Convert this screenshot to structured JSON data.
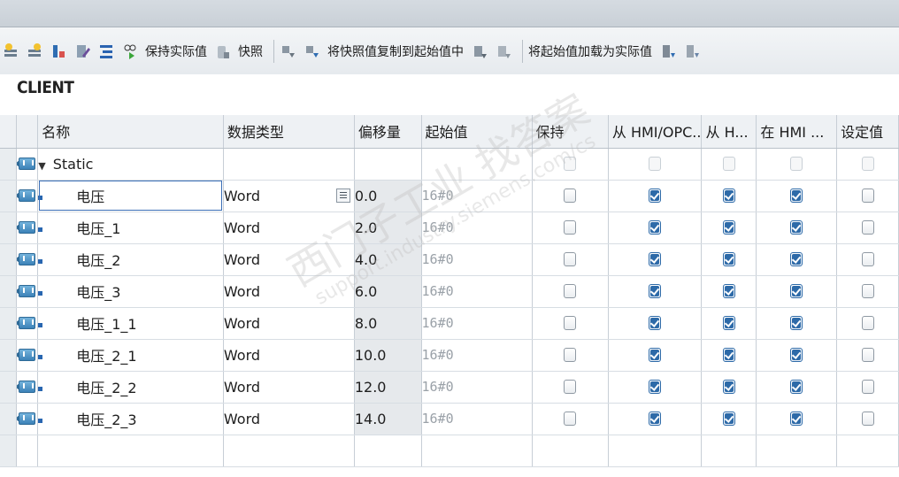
{
  "toolbar": {
    "keep_actual": "保持实际值",
    "snapshot": "快照",
    "copy_snapshot_to_start": "将快照值复制到起始值中",
    "load_start_as_actual": "将起始值加载为实际值"
  },
  "block_name": "CLIENT",
  "columns": {
    "name": "名称",
    "datatype": "数据类型",
    "offset": "偏移量",
    "start_value": "起始值",
    "retain": "保持",
    "from_hmi_opc": "从 HMI/OPC..",
    "from_h": "从 H...",
    "in_hmi": "在 HMI ...",
    "setpoint": "设定值"
  },
  "section": {
    "name": "Static"
  },
  "rows": [
    {
      "name": "电压",
      "datatype": "Word",
      "offset": "0.0",
      "start": "16#0"
    },
    {
      "name": "电压_1",
      "datatype": "Word",
      "offset": "2.0",
      "start": "16#0"
    },
    {
      "name": "电压_2",
      "datatype": "Word",
      "offset": "4.0",
      "start": "16#0"
    },
    {
      "name": "电压_3",
      "datatype": "Word",
      "offset": "6.0",
      "start": "16#0"
    },
    {
      "name": "电压_1_1",
      "datatype": "Word",
      "offset": "8.0",
      "start": "16#0"
    },
    {
      "name": "电压_2_1",
      "datatype": "Word",
      "offset": "10.0",
      "start": "16#0"
    },
    {
      "name": "电压_2_2",
      "datatype": "Word",
      "offset": "12.0",
      "start": "16#0"
    },
    {
      "name": "电压_2_3",
      "datatype": "Word",
      "offset": "14.0",
      "start": "16#0"
    }
  ],
  "checks": {
    "retain": false,
    "from_hmi_opc": true,
    "from_h": true,
    "in_hmi": true,
    "setpoint": false
  },
  "watermark": {
    "line1": "西门子工业 找答案",
    "line2": "support.industry.siemens.com/cs"
  },
  "colors": {
    "accent": "#2d6aa8",
    "grid_line": "#c7ced6",
    "toolbar_bg": "#e6eaee"
  }
}
